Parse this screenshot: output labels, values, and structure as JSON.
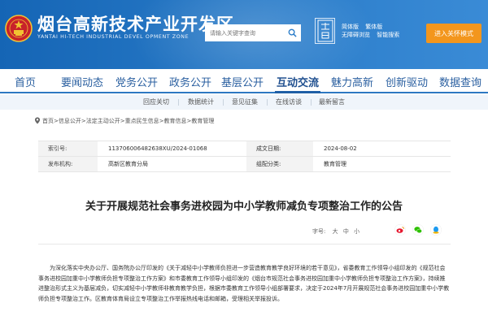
{
  "header": {
    "title": "烟台高新技术产业开发区",
    "subtitle": "YANTAI HI-TECH INDUSTRIAL DEVEL OPMENT ZONE",
    "search_placeholder": "请输入关键字查询",
    "qr_label": "烟台高新",
    "links_row1": [
      "简体版",
      "繁体版"
    ],
    "links_row2": [
      "无障碍浏览",
      "智能搜索"
    ],
    "care_mode": "进入关怀模式",
    "colors": {
      "primary": "#1565b5",
      "accent": "#f3961d"
    }
  },
  "nav": {
    "items": [
      "首页",
      "要闻动态",
      "党务公开",
      "政务公开",
      "互动交流",
      "魅力高新",
      "创新驱动",
      "数据查询"
    ],
    "active": "互动交流"
  },
  "subnav": {
    "items": [
      "回应关切",
      "数据统计",
      "意见征集",
      "在线访谈",
      "最新留言"
    ]
  },
  "breadcrumb": "首页>信息公开>法定主动公开>重点民生信息>教育信息>教育管理",
  "meta": {
    "index_label": "索引号:",
    "index_value": "113706006482638XU/2024-01068",
    "date_label": "成文日期:",
    "date_value": "2024-08-02",
    "publisher_label": "发布机构:",
    "publisher_value": "高新区教育分局",
    "category_label": "组配分类:",
    "category_value": "教育管理"
  },
  "article": {
    "title": "关于开展规范社会事务进校园为中小学教师减负专项整治工作的公告",
    "font_size_label": "字号:",
    "font_options": [
      "大",
      "中",
      "小"
    ],
    "paragraph": "为深化落实中央办公厅、国务院办公厅印发的《关于减轻中小学教师负担进一步营造教育教学良好环境的若干意见》，省委教育工作领导小组印发的《规范社会事务进校园加重中小学教师负担专项整治工作方案》和市委教育工作领导小组印发的《烟台市规范社会事务进校园加重中小学教师负担专项整治工作方案》，持续推进整治形式主义为基层减负，切实减轻中小学教师非教育教学负担，根据市委教育工作领导小组部署要求，决定于2024年7月开展规范社会事务进校园加重中小学教师负担专项整治工作。区教育体育局设立专项整治工作举报热线电话和邮箱，受理相关举报投诉。"
  }
}
